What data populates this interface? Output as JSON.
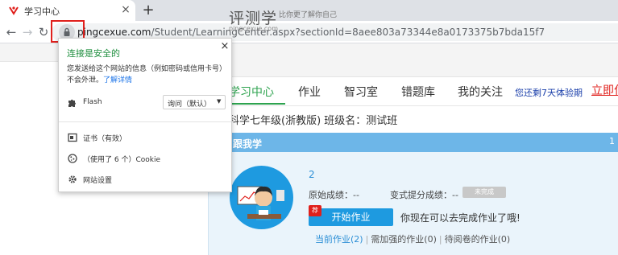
{
  "browser": {
    "tab_title": "学习中心",
    "tab_close": "×",
    "new_tab": "+",
    "nav_back": "←",
    "nav_forward": "→",
    "nav_reload": "↻",
    "url_host": "pingcexue.com",
    "url_path": "/Student/LearningCenter.aspx?sectionId=8aee803a73344e8a0173375b7bda15f7"
  },
  "site_info": {
    "title": "连接是安全的",
    "close": "×",
    "description": "您发送给这个网站的信息（例如密码或信用卡号）不会外泄。",
    "learn_more": "了解详情",
    "flash_label": "Flash",
    "flash_value": "询问（默认）",
    "certificate_label": "证书",
    "certificate_status": "（有效）",
    "cookie_label": "（使用了 6 个）Cookie",
    "site_settings_label": "网站设置"
  },
  "site": {
    "logo_text": "评测学",
    "logo_domain": "pingcexue.com",
    "slogan": "比你更了解你自己",
    "nav": [
      "学习中心",
      "作业",
      "智习室",
      "错题库",
      "我的关注"
    ],
    "trial_text": "您还剩7天体验期",
    "buy_text": "立即付",
    "class_info": "科学七年级(浙教版)   班级名：测试班",
    "panel_title": "跟我学",
    "panel_mark": "1",
    "homework_number": "2",
    "raw_score": "原始成绩：--",
    "improve_score": "变式提分成绩：--",
    "badge_text": "未完成",
    "start_flag": "荐",
    "start_button": "开始作业",
    "tip": "你现在可以去完成作业了哦!",
    "tabs": [
      "当前作业(2)",
      "需加强的作业(0)",
      "待阅卷的作业(0)"
    ],
    "tab_separator": "|"
  },
  "colors": {
    "accent_green": "#2ea34f",
    "accent_blue": "#1e9ae0",
    "highlight_red": "#e0201c",
    "secure_green": "#1e8e3e"
  }
}
